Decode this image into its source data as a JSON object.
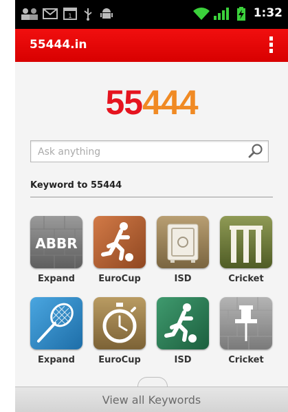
{
  "status_bar": {
    "time": "1:32",
    "icons": [
      "people-icon",
      "mail-icon",
      "calendar-icon",
      "usb-icon",
      "android-icon",
      "wifi-icon",
      "signal-icon",
      "battery-charging-icon"
    ]
  },
  "action_bar": {
    "title": "55444.in",
    "overflow_icon": "overflow-menu-icon",
    "color": "#e60a0a"
  },
  "logo": {
    "part1": "55",
    "part2": "444",
    "part1_color": "#e5141f",
    "part2_color": "#f08a24"
  },
  "search": {
    "placeholder": "Ask anything",
    "value": ""
  },
  "section": {
    "title": "Keyword to 55444"
  },
  "tiles": [
    {
      "label": "Expand",
      "icon": "abbr-icon",
      "badge": "ABBR"
    },
    {
      "label": "EuroCup",
      "icon": "soccer-player-icon"
    },
    {
      "label": "ISD",
      "icon": "safe-icon"
    },
    {
      "label": "Cricket",
      "icon": "cricket-wicket-icon"
    },
    {
      "label": "Expand",
      "icon": "badminton-racket-icon"
    },
    {
      "label": "EuroCup",
      "icon": "stopwatch-icon"
    },
    {
      "label": "ISD",
      "icon": "soccer-player-icon"
    },
    {
      "label": "Cricket",
      "icon": "pushpin-icon"
    }
  ],
  "bottom": {
    "view_all_label": "View all Keywords"
  }
}
